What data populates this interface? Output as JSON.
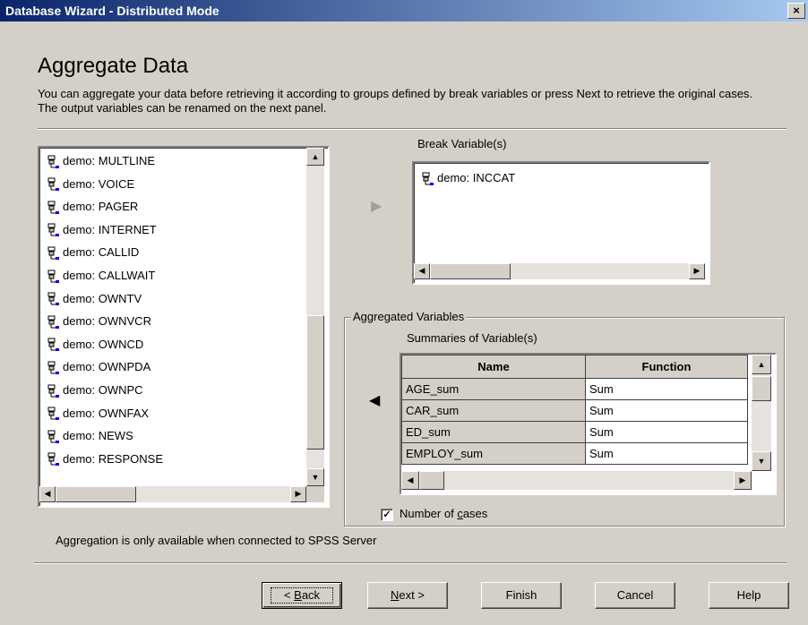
{
  "window": {
    "title": "Database Wizard - Distributed Mode",
    "close_label": "×"
  },
  "heading": "Aggregate Data",
  "description": "You can aggregate your data before retrieving it according to groups defined by break variables or press Next to retrieve the original cases. The output variables can be renamed on the next panel.",
  "source_list": {
    "items": [
      "demo: MULTLINE",
      "demo: VOICE",
      "demo: PAGER",
      "demo: INTERNET",
      "demo: CALLID",
      "demo: CALLWAIT",
      "demo: OWNTV",
      "demo: OWNVCR",
      "demo: OWNCD",
      "demo: OWNPDA",
      "demo: OWNPC",
      "demo: OWNFAX",
      "demo: NEWS",
      "demo: RESPONSE"
    ]
  },
  "break_variables": {
    "label": "Break Variable(s)",
    "items": [
      "demo: INCCAT"
    ]
  },
  "aggregated": {
    "group_label": "Aggregated Variables",
    "summaries_label": "Summaries of Variable(s)",
    "columns": [
      "Name",
      "Function"
    ],
    "rows": [
      {
        "name": "AGE_sum",
        "function": "Sum"
      },
      {
        "name": "CAR_sum",
        "function": "Sum"
      },
      {
        "name": "ED_sum",
        "function": "Sum"
      },
      {
        "name": "EMPLOY_sum",
        "function": "Sum"
      }
    ]
  },
  "number_of_cases": {
    "label_prefix": "Number of ",
    "label_accel": "c",
    "label_suffix": "ases",
    "checked": true,
    "check_glyph": "✓"
  },
  "server_note": "Aggregation is only available when connected to SPSS Server",
  "buttons": {
    "back_prefix": "< ",
    "back_accel": "B",
    "back_suffix": "ack",
    "next_accel": "N",
    "next_suffix": "ext >",
    "finish": "Finish",
    "cancel": "Cancel",
    "help": "Help"
  },
  "scroll_arrows": {
    "up": "▲",
    "down": "▼",
    "left": "◀",
    "right": "▶"
  }
}
